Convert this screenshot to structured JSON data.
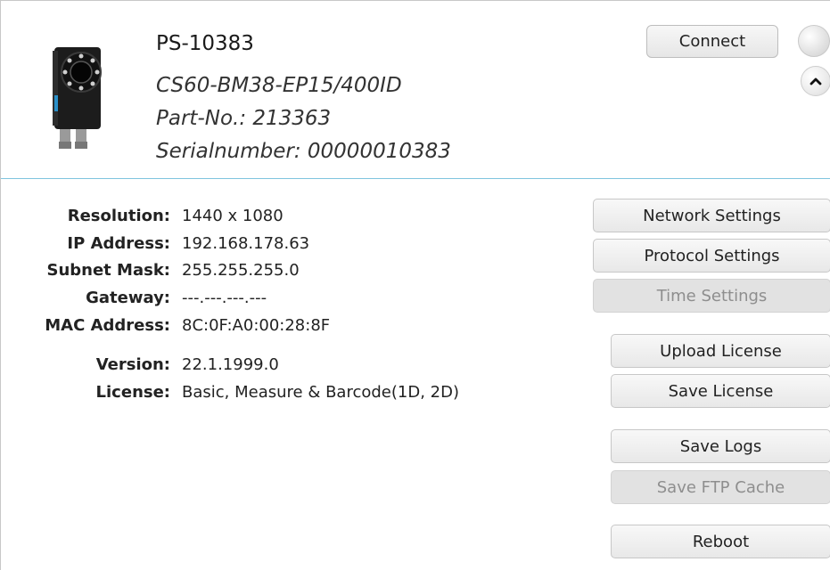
{
  "device": {
    "name": "PS-10383",
    "model": "CS60-BM38-EP15/400ID",
    "part_no": "Part-No.: 213363",
    "serial": "Serialnumber: 00000010383"
  },
  "header": {
    "connect_label": "Connect"
  },
  "info": {
    "resolution_label": "Resolution:",
    "resolution": "1440 x 1080",
    "ip_label": "IP Address:",
    "ip": "192.168.178.63",
    "subnet_label": "Subnet Mask:",
    "subnet": "255.255.255.0",
    "gateway_label": "Gateway:",
    "gateway": "---.---.---.---",
    "mac_label": "MAC Address:",
    "mac": "8C:0F:A0:00:28:8F",
    "version_label": "Version:",
    "version": "22.1.1999.0",
    "license_label": "License:",
    "license": "Basic, Measure & Barcode(1D, 2D)"
  },
  "buttons": {
    "network_settings": "Network Settings",
    "protocol_settings": "Protocol Settings",
    "time_settings": "Time Settings",
    "upload_license": "Upload License",
    "save_license": "Save License",
    "save_logs": "Save Logs",
    "save_ftp_cache": "Save FTP Cache",
    "reboot": "Reboot"
  },
  "icons": {
    "device": "camera-sensor-icon",
    "status": "status-indicator-icon",
    "collapse": "chevron-up-icon"
  }
}
